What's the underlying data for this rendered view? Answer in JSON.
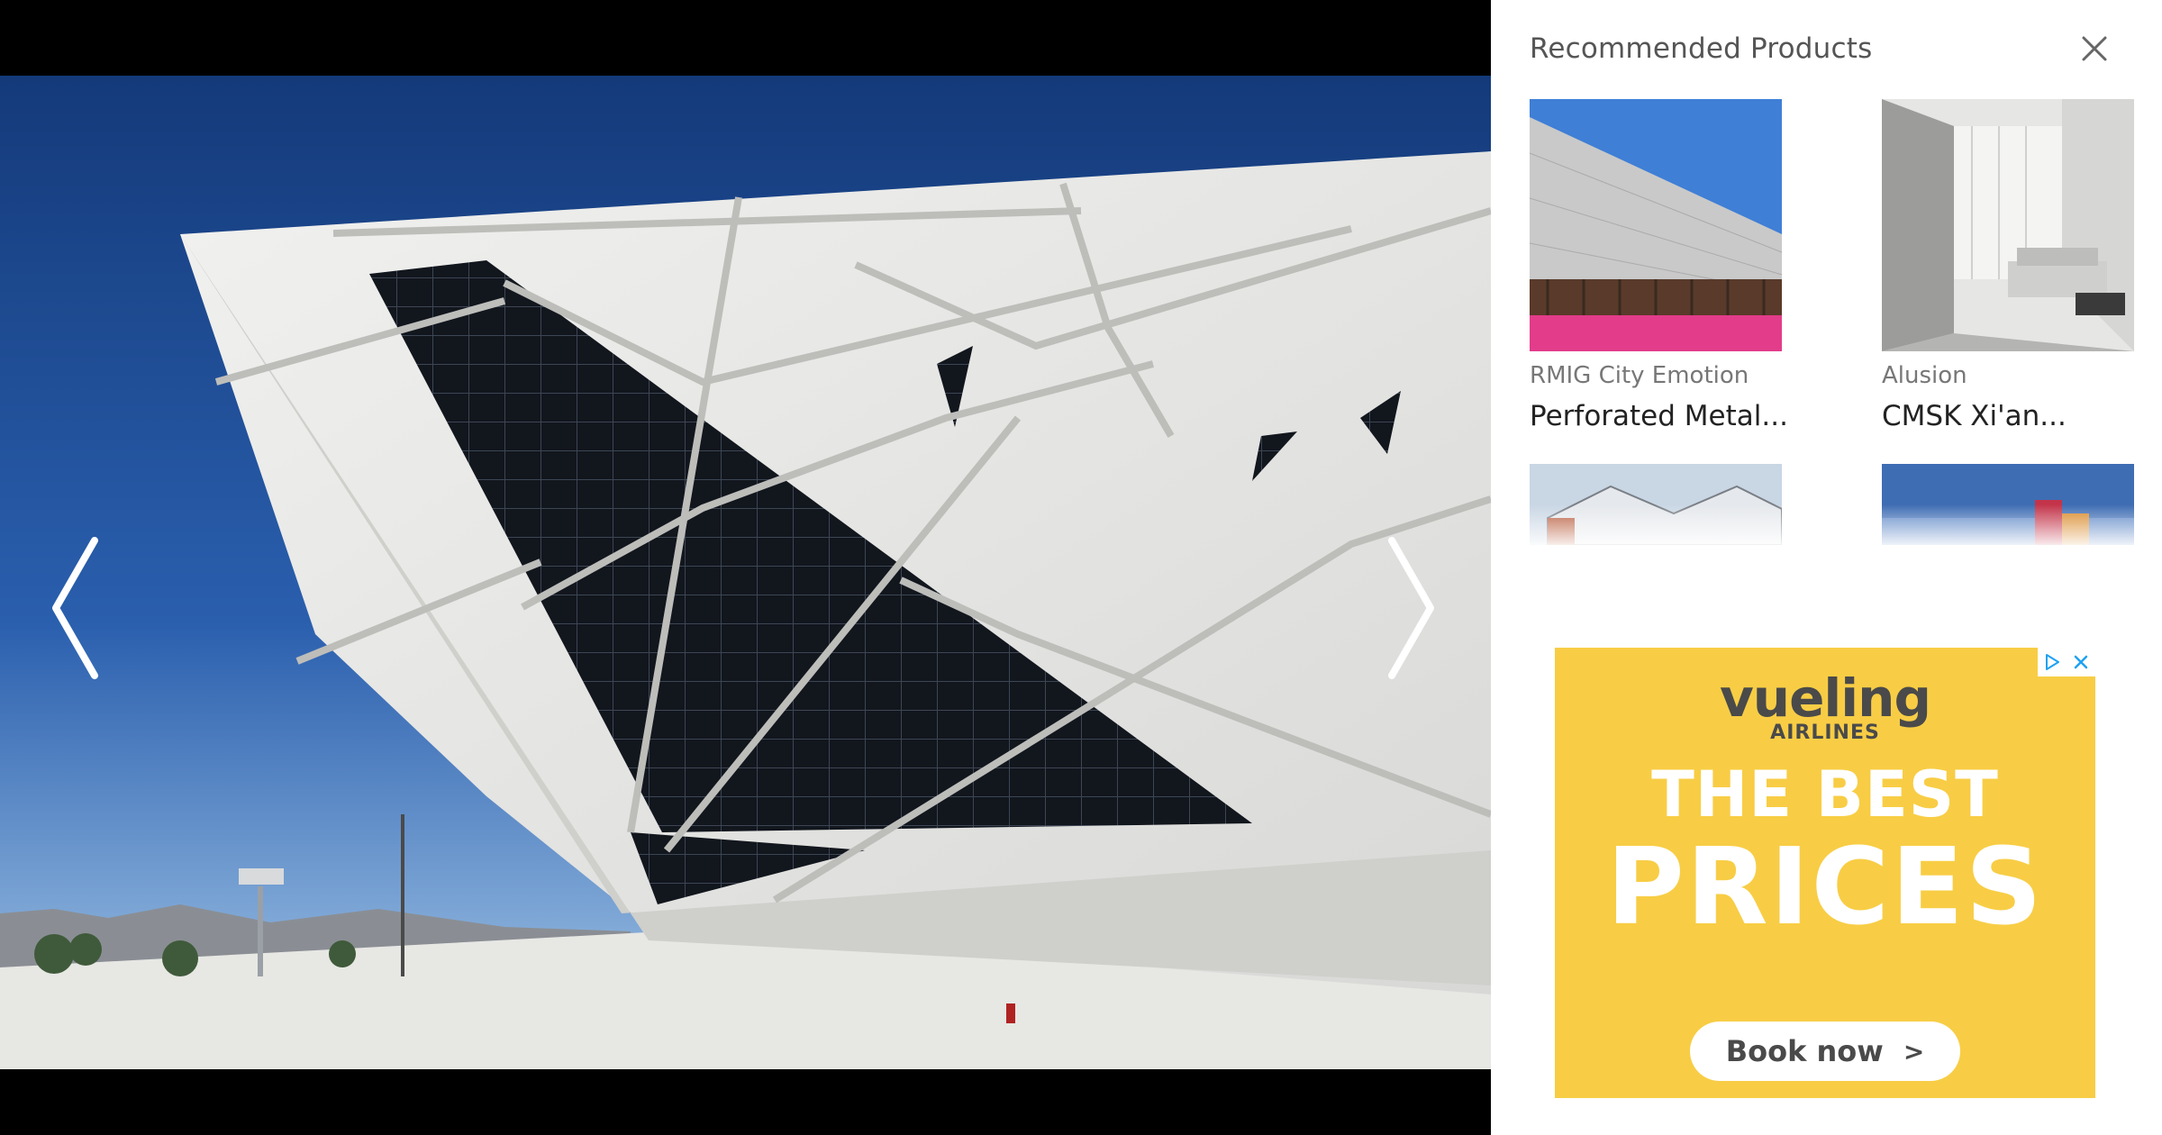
{
  "viewer": {
    "prev_label": "Previous image",
    "next_label": "Next image"
  },
  "side_panel": {
    "title": "Recommended Products",
    "close_label": "Close",
    "products": [
      {
        "brand": "RMIG City Emotion",
        "name": "Perforated Metal..."
      },
      {
        "brand": "Alusion",
        "name": "CMSK Xi'an..."
      },
      {
        "brand": "",
        "name": ""
      },
      {
        "brand": "",
        "name": ""
      }
    ]
  },
  "ad": {
    "logo": "vueling",
    "logo_sub": "AIRLINES",
    "headline_1": "THE BEST",
    "headline_2": "PRICES",
    "cta_label": "Book now",
    "cta_chevron": ">",
    "colors": {
      "background": "#f8cd45",
      "text_dark": "#4a4a4a",
      "badge_blue": "#1ea1f2"
    }
  }
}
